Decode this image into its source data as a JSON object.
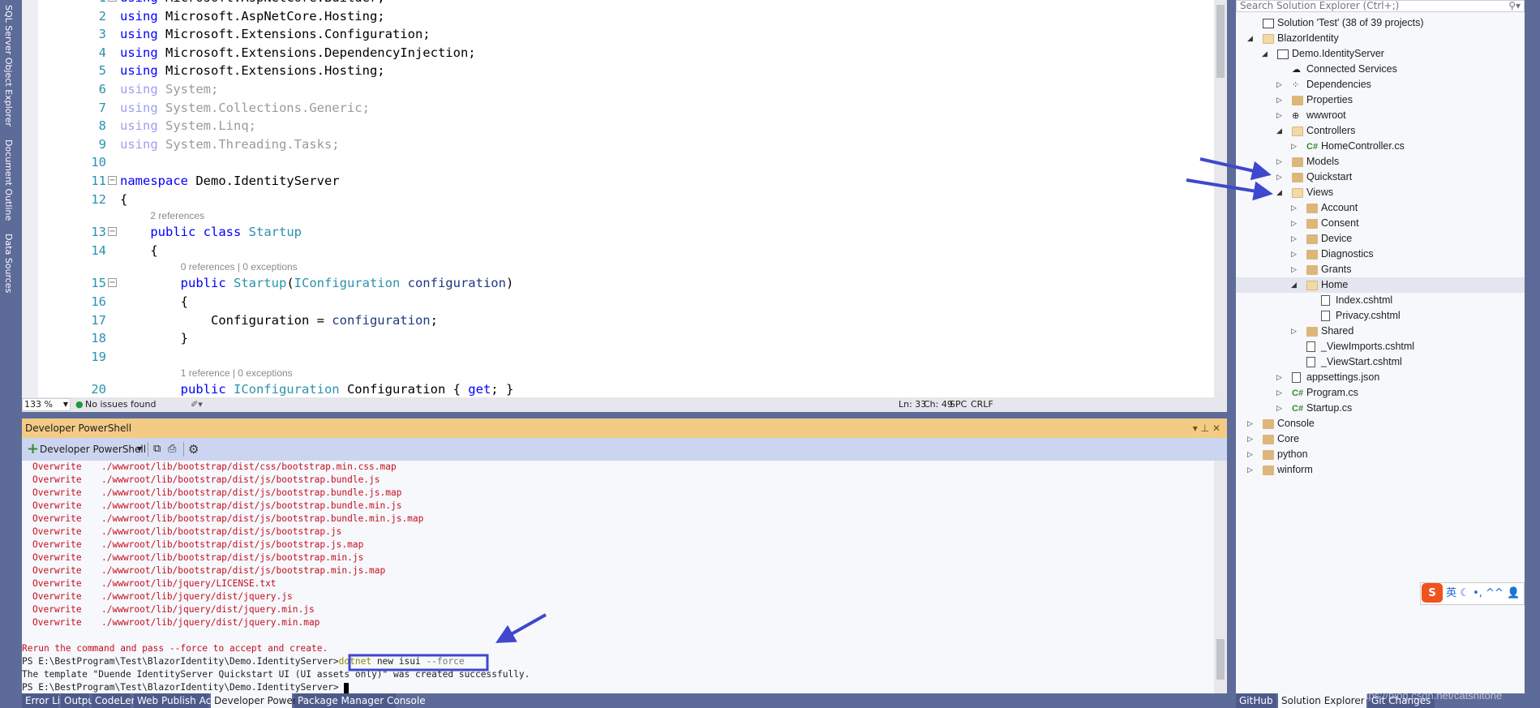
{
  "left_strip": {
    "tabs": [
      "SQL Server Object Explorer",
      "Document Outline",
      "Data Sources"
    ]
  },
  "editor": {
    "lines": [
      {
        "n": "1",
        "fold": "-",
        "tokens": [
          [
            "kw",
            "using "
          ],
          [
            "pl",
            "Microsoft.AspNetCore.Builder;"
          ]
        ]
      },
      {
        "n": "2",
        "tokens": [
          [
            "kw",
            "using "
          ],
          [
            "pl",
            "Microsoft.AspNetCore.Hosting;"
          ]
        ]
      },
      {
        "n": "3",
        "tokens": [
          [
            "kw",
            "using "
          ],
          [
            "pl",
            "Microsoft.Extensions.Configuration;"
          ]
        ]
      },
      {
        "n": "4",
        "tokens": [
          [
            "kw",
            "using "
          ],
          [
            "pl",
            "Microsoft.Extensions.DependencyInjection;"
          ]
        ]
      },
      {
        "n": "5",
        "tokens": [
          [
            "kw",
            "using "
          ],
          [
            "pl",
            "Microsoft.Extensions.Hosting;"
          ]
        ]
      },
      {
        "n": "6",
        "tokens": [
          [
            "fk",
            "using "
          ],
          [
            "fg",
            "System;"
          ]
        ]
      },
      {
        "n": "7",
        "tokens": [
          [
            "fk",
            "using "
          ],
          [
            "fg",
            "System.Collections.Generic;"
          ]
        ]
      },
      {
        "n": "8",
        "tokens": [
          [
            "fk",
            "using "
          ],
          [
            "fg",
            "System.Linq;"
          ]
        ]
      },
      {
        "n": "9",
        "tokens": [
          [
            "fk",
            "using "
          ],
          [
            "fg",
            "System.Threading.Tasks;"
          ]
        ]
      },
      {
        "n": "10",
        "tokens": []
      },
      {
        "n": "11",
        "fold": "-",
        "tokens": [
          [
            "kw",
            "namespace "
          ],
          [
            "pl",
            "Demo.IdentityServer"
          ]
        ]
      },
      {
        "n": "12",
        "tokens": [
          [
            "pl",
            "{"
          ]
        ]
      },
      {
        "lens": "2 references",
        "indent": 4
      },
      {
        "n": "13",
        "fold": "-",
        "tokens": [
          [
            "pl",
            "    "
          ],
          [
            "kw",
            "public class "
          ],
          [
            "ty",
            "Startup"
          ]
        ]
      },
      {
        "n": "14",
        "tokens": [
          [
            "pl",
            "    {"
          ]
        ]
      },
      {
        "lens": "0 references | 0 exceptions",
        "indent": 8
      },
      {
        "n": "15",
        "fold": "-",
        "tokens": [
          [
            "pl",
            "        "
          ],
          [
            "kw",
            "public "
          ],
          [
            "ty",
            "Startup"
          ],
          [
            "pl",
            "("
          ],
          [
            "ty",
            "IConfiguration "
          ],
          [
            "id",
            "configuration"
          ],
          [
            "pl",
            ")"
          ]
        ]
      },
      {
        "n": "16",
        "tokens": [
          [
            "pl",
            "        {"
          ]
        ]
      },
      {
        "n": "17",
        "tokens": [
          [
            "pl",
            "            Configuration = "
          ],
          [
            "id",
            "configuration"
          ],
          [
            "pl",
            ";"
          ]
        ]
      },
      {
        "n": "18",
        "tokens": [
          [
            "pl",
            "        }"
          ]
        ]
      },
      {
        "n": "19",
        "tokens": []
      },
      {
        "lens": "1 reference | 0 exceptions",
        "indent": 8
      },
      {
        "n": "20",
        "tokens": [
          [
            "pl",
            "        "
          ],
          [
            "kw",
            "public "
          ],
          [
            "ty",
            "IConfiguration "
          ],
          [
            "pl",
            "Configuration { "
          ],
          [
            "kw",
            "get"
          ],
          [
            "pl",
            "; }"
          ]
        ]
      }
    ],
    "status": {
      "zoom": "133 %",
      "issues": "No issues found",
      "ln": "Ln: 33",
      "ch": "Ch: 49",
      "spc": "SPC",
      "crlf": "CRLF"
    }
  },
  "tool_window": {
    "title": "Developer PowerShell",
    "new_terminal_label": "Developer PowerShell",
    "lines": [
      [
        "Overwrite",
        "./wwwroot/lib/bootstrap/dist/css/bootstrap.min.css.map"
      ],
      [
        "Overwrite",
        "./wwwroot/lib/bootstrap/dist/js/bootstrap.bundle.js"
      ],
      [
        "Overwrite",
        "./wwwroot/lib/bootstrap/dist/js/bootstrap.bundle.js.map"
      ],
      [
        "Overwrite",
        "./wwwroot/lib/bootstrap/dist/js/bootstrap.bundle.min.js"
      ],
      [
        "Overwrite",
        "./wwwroot/lib/bootstrap/dist/js/bootstrap.bundle.min.js.map"
      ],
      [
        "Overwrite",
        "./wwwroot/lib/bootstrap/dist/js/bootstrap.js"
      ],
      [
        "Overwrite",
        "./wwwroot/lib/bootstrap/dist/js/bootstrap.js.map"
      ],
      [
        "Overwrite",
        "./wwwroot/lib/bootstrap/dist/js/bootstrap.min.js"
      ],
      [
        "Overwrite",
        "./wwwroot/lib/bootstrap/dist/js/bootstrap.min.js.map"
      ],
      [
        "Overwrite",
        "./wwwroot/lib/jquery/LICENSE.txt"
      ],
      [
        "Overwrite",
        "./wwwroot/lib/jquery/dist/jquery.js"
      ],
      [
        "Overwrite",
        "./wwwroot/lib/jquery/dist/jquery.min.js"
      ],
      [
        "Overwrite",
        "./wwwroot/lib/jquery/dist/jquery.min.map"
      ]
    ],
    "rerun": "Rerun the command and pass --force to accept and create.",
    "prompt": "PS E:\\BestProgram\\Test\\BlazorIdentity\\Demo.IdentityServer>",
    "cmd_dotnet": "dotnet",
    "cmd_args": " new isui ",
    "cmd_force": "--force",
    "success": "The template \"Duende IdentityServer Quickstart UI (UI assets only)\" was created successfully."
  },
  "bottom_tabs": [
    "Error List",
    "Output",
    "CodeLens",
    "Web Publish Activity",
    "Developer PowerShell",
    "Package Manager Console"
  ],
  "active_bottom_tab": "Developer PowerShell",
  "solution_explorer": {
    "search_placeholder": "Search Solution Explorer (Ctrl+;)",
    "items": [
      {
        "label": "Solution 'Test' (38 of 39 projects)",
        "level": 0,
        "icon": "solution",
        "exp": ""
      },
      {
        "label": "BlazorIdentity",
        "level": 0,
        "icon": "folder-open",
        "exp": "open"
      },
      {
        "label": "Demo.IdentityServer",
        "level": 1,
        "icon": "project",
        "exp": "open"
      },
      {
        "label": "Connected Services",
        "level": 2,
        "icon": "connected",
        "exp": ""
      },
      {
        "label": "Dependencies",
        "level": 2,
        "icon": "dependencies",
        "exp": "closed"
      },
      {
        "label": "Properties",
        "level": 2,
        "icon": "properties",
        "exp": "closed"
      },
      {
        "label": "wwwroot",
        "level": 2,
        "icon": "globe",
        "exp": "closed"
      },
      {
        "label": "Controllers",
        "level": 2,
        "icon": "folder-open",
        "exp": "open"
      },
      {
        "label": "HomeController.cs",
        "level": 3,
        "icon": "csharp",
        "exp": "closed"
      },
      {
        "label": "Models",
        "level": 2,
        "icon": "folder",
        "exp": "closed"
      },
      {
        "label": "Quickstart",
        "level": 2,
        "icon": "folder",
        "exp": "closed"
      },
      {
        "label": "Views",
        "level": 2,
        "icon": "folder-open",
        "exp": "open"
      },
      {
        "label": "Account",
        "level": 3,
        "icon": "folder",
        "exp": "closed"
      },
      {
        "label": "Consent",
        "level": 3,
        "icon": "folder",
        "exp": "closed"
      },
      {
        "label": "Device",
        "level": 3,
        "icon": "folder",
        "exp": "closed"
      },
      {
        "label": "Diagnostics",
        "level": 3,
        "icon": "folder",
        "exp": "closed"
      },
      {
        "label": "Grants",
        "level": 3,
        "icon": "folder",
        "exp": "closed"
      },
      {
        "label": "Home",
        "level": 3,
        "icon": "folder-open",
        "exp": "open",
        "selected": true
      },
      {
        "label": "Index.cshtml",
        "level": 4,
        "icon": "razor",
        "exp": ""
      },
      {
        "label": "Privacy.cshtml",
        "level": 4,
        "icon": "razor",
        "exp": ""
      },
      {
        "label": "Shared",
        "level": 3,
        "icon": "folder",
        "exp": "closed"
      },
      {
        "label": "_ViewImports.cshtml",
        "level": 3,
        "icon": "razor",
        "exp": ""
      },
      {
        "label": "_ViewStart.cshtml",
        "level": 3,
        "icon": "razor",
        "exp": ""
      },
      {
        "label": "appsettings.json",
        "level": 2,
        "icon": "json",
        "exp": "closed"
      },
      {
        "label": "Program.cs",
        "level": 2,
        "icon": "csharp",
        "exp": "closed"
      },
      {
        "label": "Startup.cs",
        "level": 2,
        "icon": "csharp",
        "exp": "closed"
      },
      {
        "label": "Console",
        "level": 0,
        "icon": "folder",
        "exp": "closed"
      },
      {
        "label": "Core",
        "level": 0,
        "icon": "folder",
        "exp": "closed"
      },
      {
        "label": "python",
        "level": 0,
        "icon": "folder",
        "exp": "closed"
      },
      {
        "label": "winform",
        "level": 0,
        "icon": "folder",
        "exp": "closed"
      }
    ],
    "tabs": [
      "GitHub",
      "Solution Explorer",
      "Git Changes"
    ],
    "active_tab": "Solution Explorer"
  },
  "ime": {
    "mode": "英"
  },
  "watermark": "https://blog.csdn.net/catshitone",
  "colors": {
    "annotation": "#3f48cc",
    "accent": "#f3cb85",
    "terminal_error": "#c50f1f"
  }
}
